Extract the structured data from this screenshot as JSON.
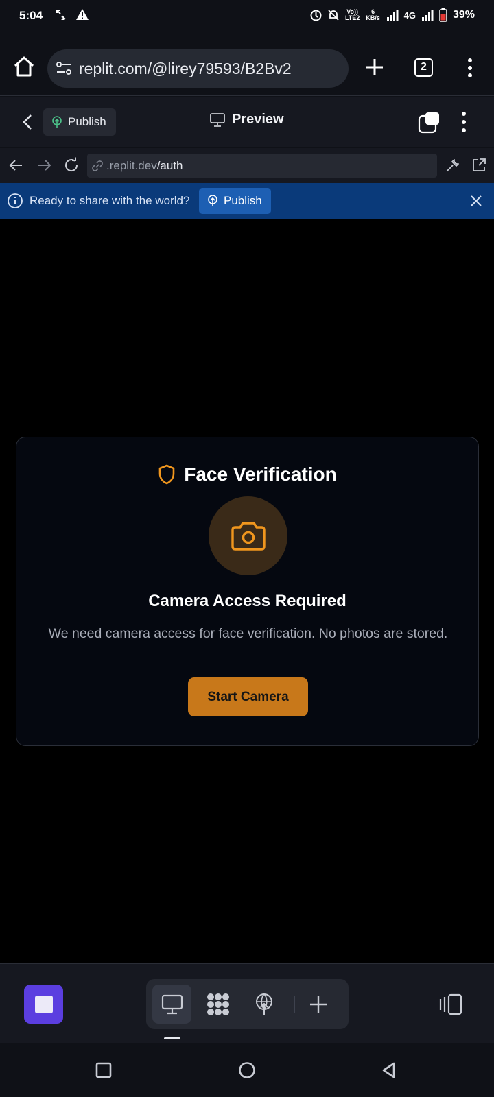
{
  "status_bar": {
    "time": "5:04",
    "volte": "Vo)) LTE2",
    "net_speed": "6 KB/s",
    "network": "4G",
    "battery": "39%",
    "icons": [
      "call-forward-icon",
      "warning-icon",
      "sync-icon",
      "mute-icon",
      "signal-icon",
      "battery-icon"
    ]
  },
  "browser": {
    "url": "replit.com/@lirey79593/B2Bv2",
    "tab_count": "2",
    "icons": [
      "home-icon",
      "tune-icon",
      "plus-icon",
      "more-vertical-icon"
    ]
  },
  "replit_header": {
    "publish_label": "Publish",
    "title": "Preview",
    "icons": [
      "chevron-left-icon",
      "publish-icon",
      "monitor-icon",
      "split-view-icon",
      "more-vertical-icon"
    ]
  },
  "webview": {
    "domain": ".replit.dev",
    "path": "/auth",
    "icons": [
      "arrow-left-icon",
      "arrow-right-icon",
      "reload-icon",
      "link-icon",
      "wrench-icon",
      "external-link-icon"
    ]
  },
  "banner": {
    "text": "Ready to share with the world?",
    "publish_label": "Publish",
    "icons": [
      "info-icon",
      "publish-icon",
      "close-icon"
    ]
  },
  "card": {
    "title": "Face Verification",
    "heading": "Camera Access Required",
    "description": "We need camera access for face verification. No photos are stored.",
    "button_label": "Start Camera",
    "accent_color": "#f0961e",
    "button_color": "#c8781a",
    "icons": [
      "shield-icon",
      "camera-icon"
    ]
  },
  "dock": {
    "icons": [
      "stop-icon",
      "monitor-icon",
      "agent-icon",
      "publish-icon",
      "plus-icon",
      "panels-icon"
    ],
    "active_tab": "monitor"
  },
  "android_nav": {
    "icons": [
      "recents-icon",
      "home-icon",
      "back-icon"
    ]
  }
}
